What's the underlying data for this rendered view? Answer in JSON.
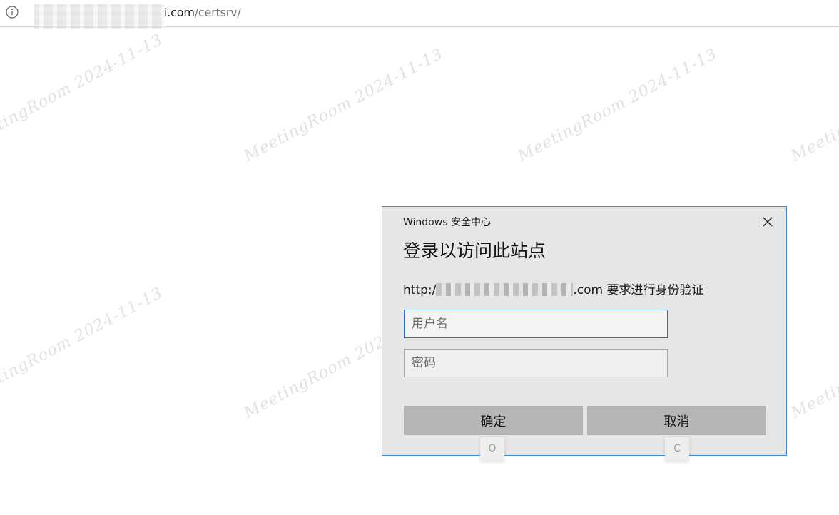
{
  "browser": {
    "url_domain_suffix": "i.com",
    "url_path": "/certsrv/"
  },
  "watermark": {
    "text": "MeetingRoom 2024-11-13"
  },
  "dialog": {
    "caption": "Windows 安全中心",
    "title": "登录以访问此站点",
    "message_prefix": "http:/",
    "message_suffix": ".com 要求进行身份验证",
    "username_placeholder": "用户名",
    "password_placeholder": "密码",
    "ok_label": "确定",
    "cancel_label": "取消",
    "ok_accesskey": "O",
    "cancel_accesskey": "C",
    "accent_color": "#3d8ad1"
  },
  "icons": {
    "info": "info-circle-icon",
    "close": "close-icon"
  }
}
